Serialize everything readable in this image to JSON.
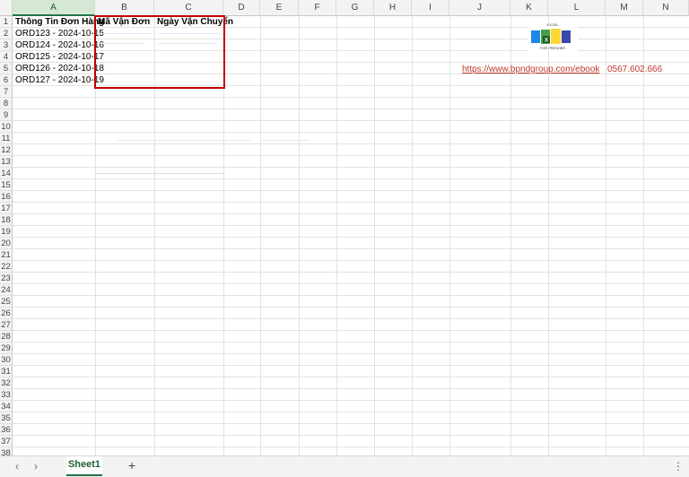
{
  "columns": [
    "A",
    "B",
    "C",
    "D",
    "E",
    "F",
    "G",
    "H",
    "I",
    "J",
    "K",
    "L",
    "M",
    "N"
  ],
  "rows": [
    "1",
    "2",
    "3",
    "4",
    "5",
    "6",
    "7",
    "8",
    "9",
    "10",
    "11",
    "12",
    "13",
    "14",
    "15",
    "16",
    "17",
    "18",
    "19",
    "20",
    "21",
    "22",
    "23",
    "24",
    "25",
    "26",
    "27",
    "28",
    "29",
    "30",
    "31",
    "32",
    "33",
    "34",
    "35",
    "36",
    "37",
    "38"
  ],
  "cells": {
    "a1": "Thông Tin Đơn Hàng",
    "b1": "Mã Vận Đơn",
    "c1": "Ngày Vận Chuyển",
    "a2": "ORD123 - 2024-10-15",
    "a3": "ORD124 - 2024-10-16",
    "a4": "ORD125 - 2024-10-17",
    "a5": "ORD126 - 2024-10-18",
    "a6": "ORD127 - 2024-10-19"
  },
  "side": {
    "link": "https://www.bpndgroup.com/ebook",
    "phone": "0567.602.666"
  },
  "logo": {
    "icon": "excel-ebook-logo",
    "top_text": "EXCEL",
    "bottom_text": "FOR FRESHER"
  },
  "tabs": {
    "sheet1": "Sheet1",
    "add_label": "+",
    "prev_icon": "chevron-left-icon",
    "next_icon": "chevron-right-icon",
    "more_icon": "vertical-ellipsis-icon"
  },
  "colors": {
    "accent": "#217346",
    "selection_border": "#c00000",
    "link": "#c0392b"
  }
}
